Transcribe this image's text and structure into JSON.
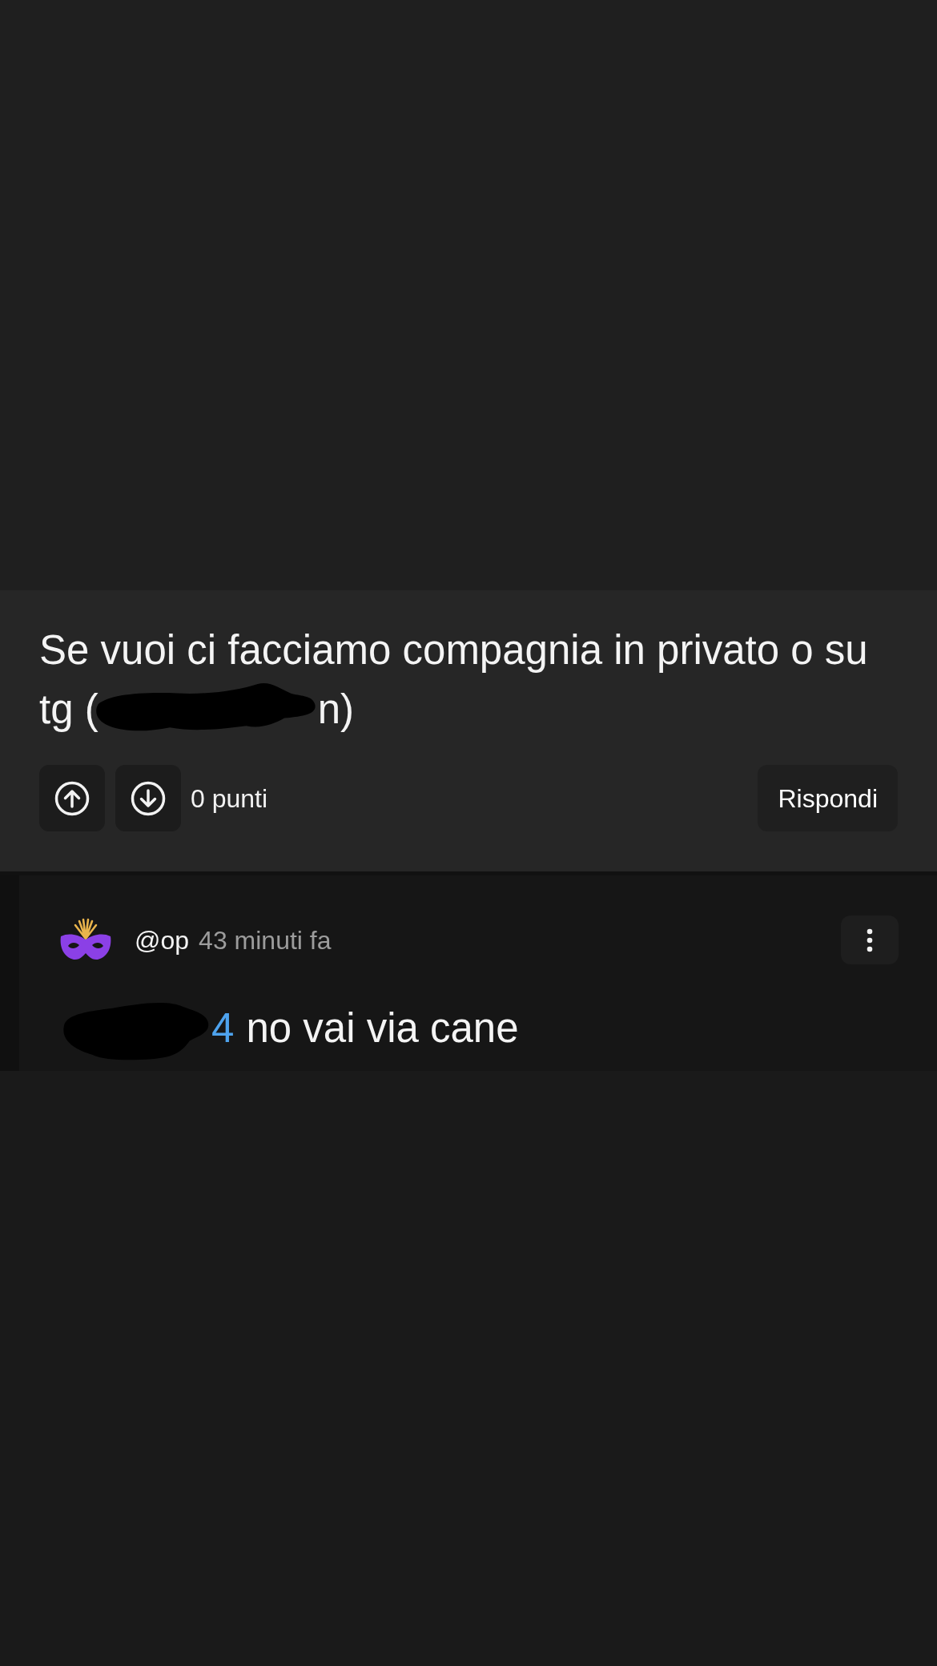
{
  "comment": {
    "lines": [
      [
        {
          "kind": "text",
          "text": "Se vuoi ci facciamo compagnia in privato o su"
        }
      ],
      [
        {
          "kind": "text",
          "text": "tg ("
        },
        {
          "kind": "redaction"
        },
        {
          "kind": "text",
          "text": "n)"
        }
      ]
    ],
    "vote_buttons": [
      {
        "kind": "up"
      },
      {
        "kind": "down"
      }
    ],
    "score": "0 punti",
    "reply_button": "Rispondi"
  },
  "reply": {
    "author": "@op",
    "time": "43 minuti fa",
    "body_parts": [
      {
        "kind": "redaction"
      },
      {
        "kind": "mention",
        "text": "4"
      },
      {
        "kind": "text",
        "text": "no vai via cane"
      }
    ]
  }
}
